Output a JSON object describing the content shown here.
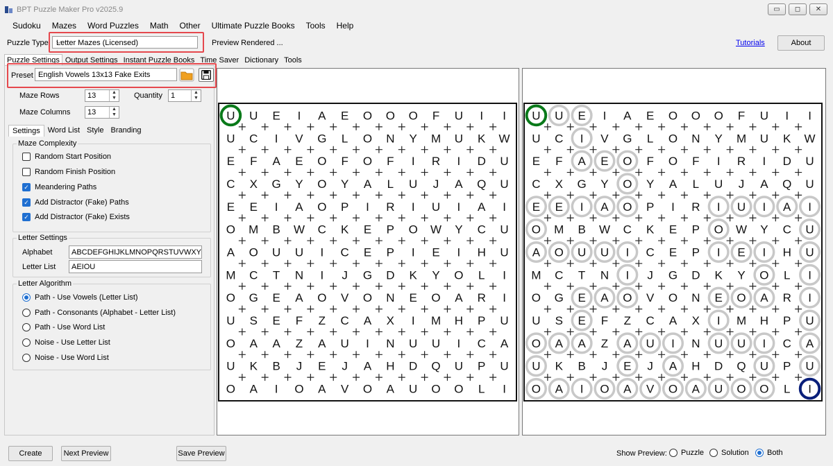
{
  "window": {
    "title": "BPT Puzzle Maker Pro v2025.9",
    "controls": [
      "▭",
      "◻",
      "✕"
    ]
  },
  "menu": [
    "Sudoku",
    "Mazes",
    "Word Puzzles",
    "Math",
    "Other",
    "Ultimate Puzzle Books",
    "Tools",
    "Help"
  ],
  "toolbar": {
    "puzzle_type_label": "Puzzle Type",
    "puzzle_type_value": "Letter Mazes (Licensed)",
    "preview_status": "Preview Rendered ...",
    "tutorials_link": "Tutorials",
    "about_button": "About"
  },
  "main_tabs": [
    "Puzzle Settings",
    "Output Settings",
    "Instant Puzzle Books",
    "Time Saver",
    "Dictionary",
    "Tools"
  ],
  "preset": {
    "label": "Preset",
    "value": "English Vowels 13x13 Fake Exits"
  },
  "maze_dims": {
    "rows_label": "Maze Rows",
    "rows_value": "13",
    "cols_label": "Maze Columns",
    "cols_value": "13",
    "quantity_label": "Quantity",
    "quantity_value": "1"
  },
  "sub_tabs": [
    "Settings",
    "Word List",
    "Style",
    "Branding"
  ],
  "complexity": {
    "title": "Maze Complexity",
    "options": [
      {
        "label": "Random Start Position",
        "checked": false
      },
      {
        "label": "Random Finish Position",
        "checked": false
      },
      {
        "label": "Meandering Paths",
        "checked": true
      },
      {
        "label": "Add Distractor (Fake) Paths",
        "checked": true
      },
      {
        "label": "Add Distractor (Fake) Exists",
        "checked": true
      }
    ]
  },
  "letter_settings": {
    "title": "Letter Settings",
    "alphabet_label": "Alphabet",
    "alphabet_value": "ABCDEFGHIJKLMNOPQRSTUVWXYZ",
    "letter_list_label": "Letter List",
    "letter_list_value": "AEIOU"
  },
  "letter_algorithm": {
    "title": "Letter Algorithm",
    "options": [
      {
        "label": "Path - Use Vowels (Letter List)",
        "checked": true
      },
      {
        "label": "Path - Consonants (Alphabet - Letter List)",
        "checked": false
      },
      {
        "label": "Path - Use Word List",
        "checked": false
      },
      {
        "label": "Noise - Use Letter List",
        "checked": false
      },
      {
        "label": "Noise - Use Word List",
        "checked": false
      }
    ]
  },
  "bottom": {
    "create": "Create",
    "next_preview": "Next Preview",
    "save_preview": "Save Preview",
    "show_preview_label": "Show Preview:",
    "options": [
      {
        "label": "Puzzle",
        "checked": false
      },
      {
        "label": "Solution",
        "checked": false
      },
      {
        "label": "Both",
        "checked": true
      }
    ]
  },
  "maze": {
    "grid": [
      "UUEIAEOOOFUII",
      "UCIVGLONYMUKW",
      "EFAEOFOFIRIDU",
      "CXGYOYALUJAQU",
      "EEIAOPIRIUIAI",
      "OMBWCKEPOWYCU",
      "AOUUICEPIEIHU",
      "MCTNIJGDKYOLI",
      "OGEAOVONEOARI",
      "USEFZCAXIMHPU",
      "OAAZAUINUUICA",
      "UKBJEJAHDQUPU",
      "OAIOAVOAUOOLI"
    ],
    "solution_cells": [
      [
        0,
        1
      ],
      [
        0,
        2
      ],
      [
        1,
        2
      ],
      [
        2,
        2
      ],
      [
        2,
        3
      ],
      [
        2,
        4
      ],
      [
        3,
        4
      ],
      [
        4,
        0
      ],
      [
        4,
        1
      ],
      [
        4,
        2
      ],
      [
        4,
        3
      ],
      [
        4,
        4
      ],
      [
        4,
        8
      ],
      [
        4,
        9
      ],
      [
        4,
        10
      ],
      [
        4,
        11
      ],
      [
        4,
        12
      ],
      [
        5,
        0
      ],
      [
        5,
        8
      ],
      [
        5,
        12
      ],
      [
        6,
        0
      ],
      [
        6,
        1
      ],
      [
        6,
        2
      ],
      [
        6,
        3
      ],
      [
        6,
        4
      ],
      [
        6,
        8
      ],
      [
        6,
        9
      ],
      [
        6,
        10
      ],
      [
        6,
        12
      ],
      [
        7,
        4
      ],
      [
        7,
        10
      ],
      [
        7,
        12
      ],
      [
        8,
        2
      ],
      [
        8,
        3
      ],
      [
        8,
        4
      ],
      [
        8,
        8
      ],
      [
        8,
        9
      ],
      [
        8,
        10
      ],
      [
        8,
        12
      ],
      [
        9,
        2
      ],
      [
        9,
        8
      ],
      [
        9,
        12
      ],
      [
        10,
        0
      ],
      [
        10,
        1
      ],
      [
        10,
        2
      ],
      [
        10,
        4
      ],
      [
        10,
        5
      ],
      [
        10,
        6
      ],
      [
        10,
        8
      ],
      [
        10,
        9
      ],
      [
        10,
        10
      ],
      [
        10,
        12
      ],
      [
        11,
        0
      ],
      [
        11,
        4
      ],
      [
        11,
        6
      ],
      [
        11,
        10
      ],
      [
        11,
        12
      ],
      [
        12,
        0
      ],
      [
        12,
        1
      ],
      [
        12,
        2
      ],
      [
        12,
        3
      ],
      [
        12,
        4
      ],
      [
        12,
        5
      ],
      [
        12,
        6
      ],
      [
        12,
        7
      ],
      [
        12,
        8
      ],
      [
        12,
        9
      ],
      [
        12,
        10
      ]
    ],
    "start_cell": [
      0,
      0
    ],
    "finish_cell": [
      12,
      12
    ],
    "colors": {
      "start": "#0a7a1a",
      "finish": "#0a1f7a",
      "solution": "#c8c8c8",
      "highlight": "#e5484d",
      "accent": "#1f6fd1"
    }
  }
}
